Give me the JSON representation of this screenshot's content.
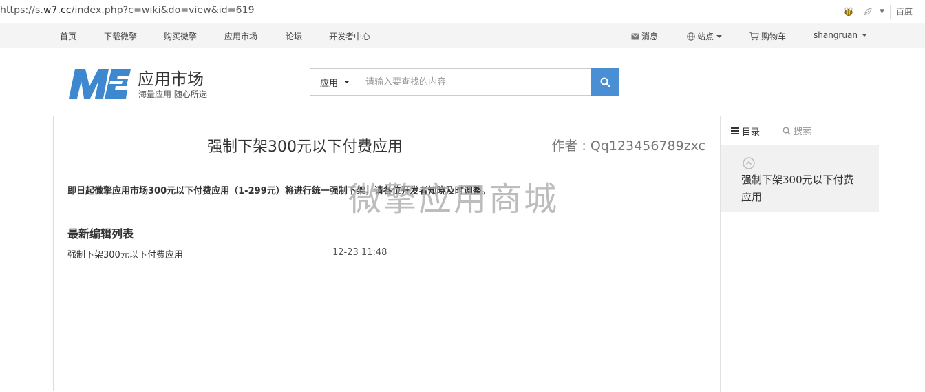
{
  "browser": {
    "url_prefix": "https://s.",
    "url_domain": "w7.cc",
    "url_path": "/index.php?c=wiki&do=view&id=619",
    "search_engine": "百度"
  },
  "topnav": {
    "links": [
      "首页",
      "下载微擎",
      "购买微擎",
      "应用市场",
      "论坛",
      "开发者中心"
    ],
    "messages": "消息",
    "sites": "站点",
    "cart": "购物车",
    "user": "shangruan"
  },
  "brand": {
    "name": "应用市场",
    "slogan": "海量应用 随心所选"
  },
  "search": {
    "category": "应用",
    "placeholder": "请输入要查找的内容"
  },
  "article": {
    "title": "强制下架300元以下付费应用",
    "author": "作者 : Qq123456789zxc",
    "notice": "即日起微擎应用市场300元以下付费应用（1-299元）将进行统一强制下架，请各位开发者知晓及时调整。",
    "watermark": "微擎应用商城",
    "recent_heading": "最新编辑列表",
    "recent": [
      {
        "title": "强制下架300元以下付费应用",
        "time": "12-23 11:48"
      }
    ]
  },
  "sidebar": {
    "tab_toc": "目录",
    "tab_search": "搜索",
    "toc_items": [
      "强制下架300元以下付费应用"
    ]
  },
  "colors": {
    "accent": "#4a8fd4",
    "logo": "#3d88cf"
  }
}
